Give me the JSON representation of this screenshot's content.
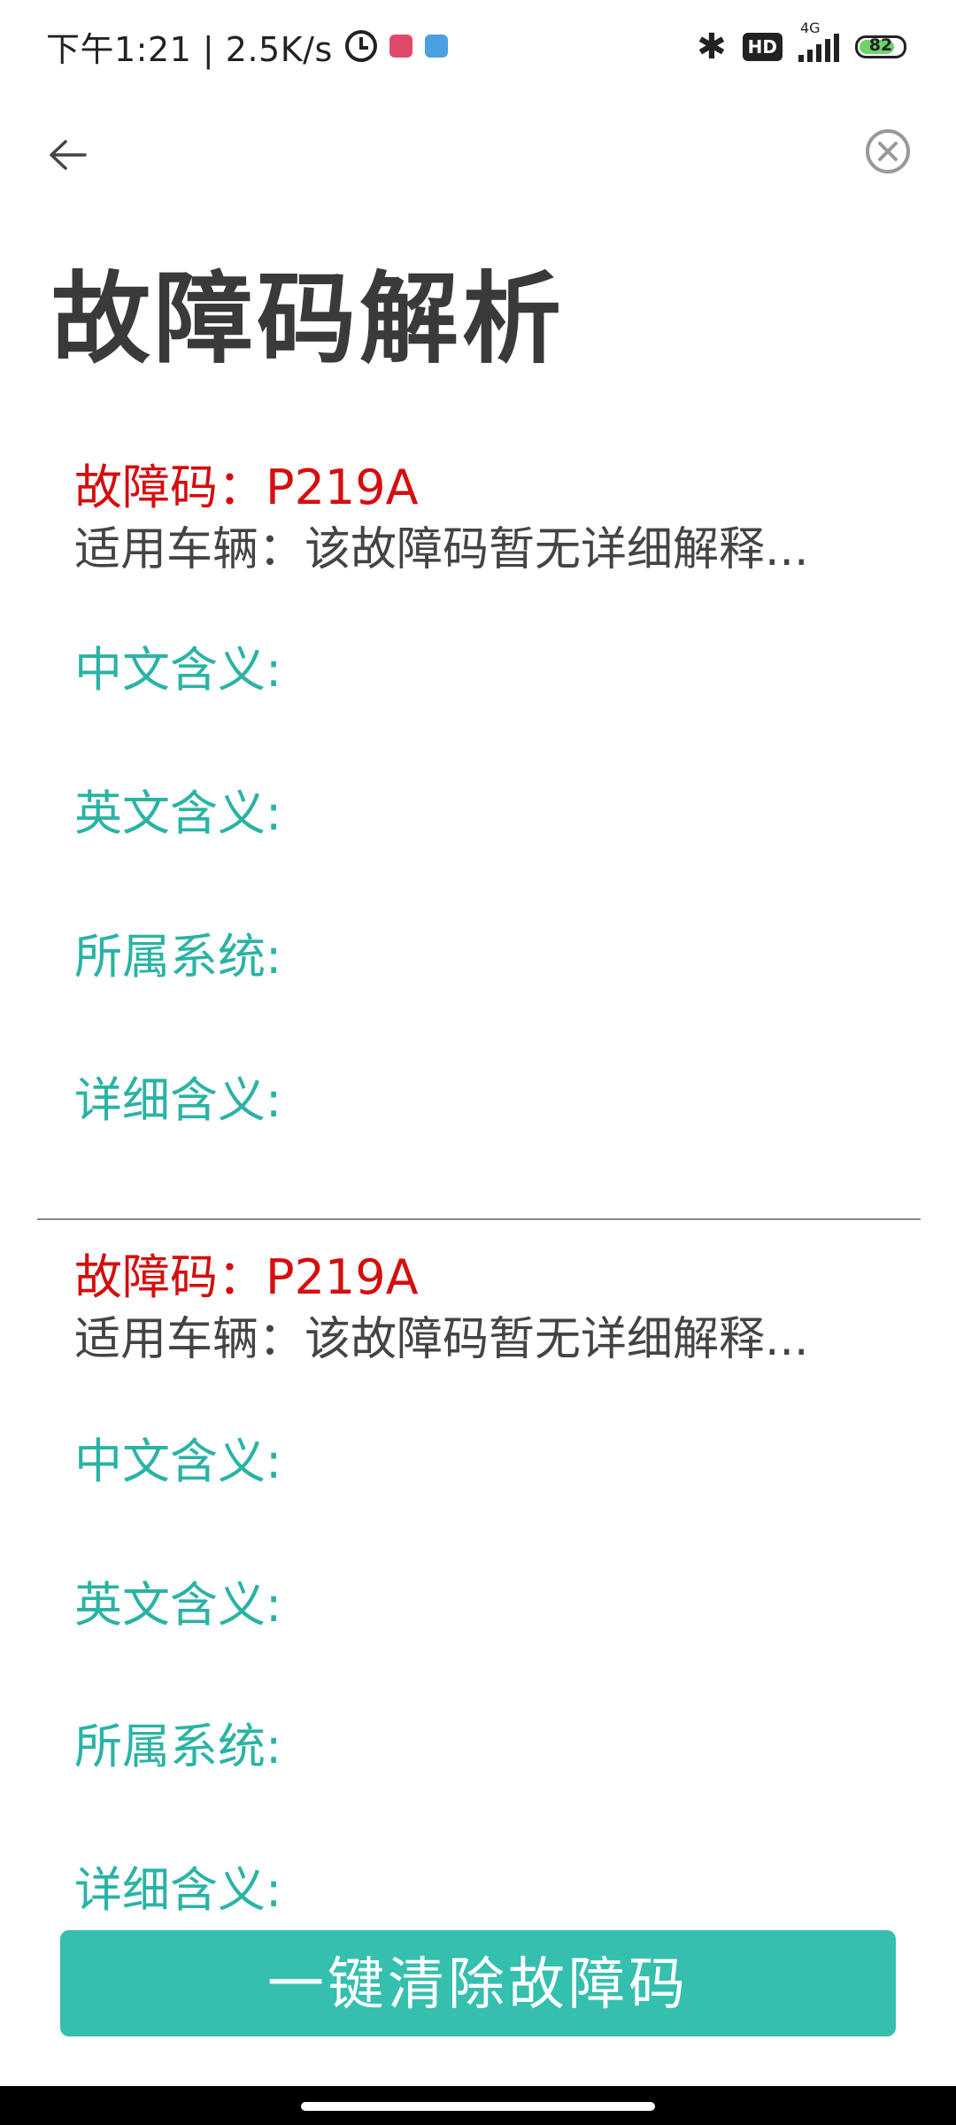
{
  "status_bar": {
    "time_speed": "下午1:21 | 2.5K/s",
    "network_label": "4G",
    "hd_label": "HD",
    "battery": "82"
  },
  "page": {
    "title": "故障码解析"
  },
  "results": [
    {
      "code_label": "故障码：P219A",
      "vehicle_label": "适用车辆：该故障码暂无详细解释...",
      "chinese_meaning": "中文含义:",
      "english_meaning": "英文含义:",
      "system": "所属系统:",
      "detail": "详细含义:"
    },
    {
      "code_label": "故障码：P219A",
      "vehicle_label": "适用车辆：该故障码暂无详细解释...",
      "chinese_meaning": "中文含义:",
      "english_meaning": "英文含义:",
      "system": "所属系统:",
      "detail": "详细含义:"
    }
  ],
  "actions": {
    "clear_button": "一键清除故障码"
  },
  "icons": {
    "back": "arrow-left-icon",
    "close": "close-circle-icon"
  },
  "colors": {
    "code": "#d40e0e",
    "field_label": "#2ab3a4",
    "button": "#35bfae"
  }
}
